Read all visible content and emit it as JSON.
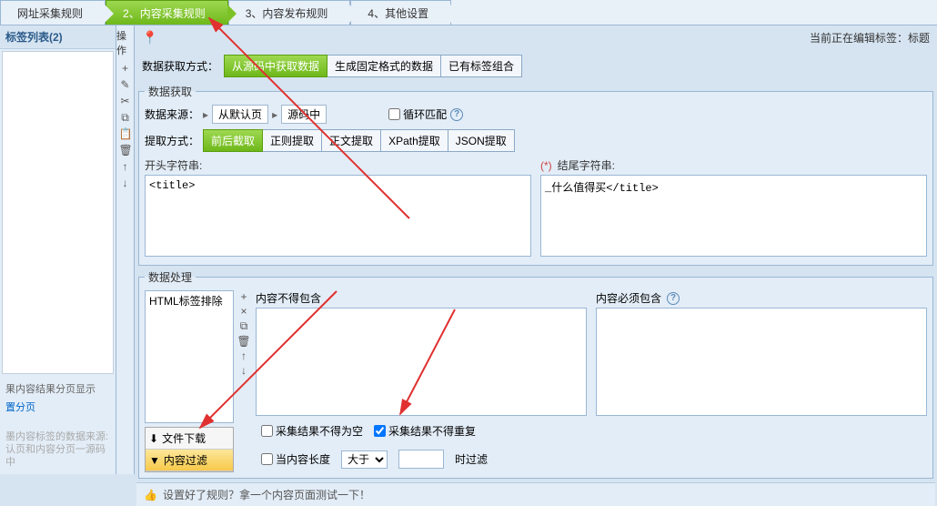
{
  "tabs": {
    "t1": "网址采集规则",
    "t2": "2、内容采集规则",
    "t3": "3、内容发布规则",
    "t4": "4、其他设置"
  },
  "left": {
    "header": "标签列表(2)",
    "op_label": "操作",
    "paging_title": "果内容结果分页显示",
    "paging_link": "置分页",
    "hint1": "墨内容标签的数据来源:",
    "hint2": "认页和内容分页一源码中"
  },
  "top": {
    "pin_icon": "pin-icon",
    "status_prefix": "当前正在编辑标签：",
    "status_value": "标题",
    "extract_method_label": "数据获取方式：",
    "method_btn1": "从源码中获取数据",
    "method_btn2": "生成固定格式的数据",
    "method_btn3": "已有标签组合"
  },
  "acquire": {
    "legend": "数据获取",
    "src_label": "数据来源：",
    "src1": "从默认页",
    "src2": "源码中",
    "loop_label": "循环匹配",
    "ext_label": "提取方式：",
    "ext_btns": [
      "前后截取",
      "正则提取",
      "正文提取",
      "XPath提取",
      "JSON提取"
    ],
    "start_label": "开头字符串:",
    "end_star": "(*)",
    "end_label": "结尾字符串:",
    "start_value": "<title>",
    "end_value": "_什么值得买</title>"
  },
  "process": {
    "legend": "数据处理",
    "list_item": "HTML标签排除",
    "not_contain_label": "内容不得包含",
    "must_contain_label": "内容必须包含",
    "bt1": "文件下载",
    "bt2": "内容过滤",
    "chk_notempty": "采集结果不得为空",
    "chk_norepeat": "采集结果不得重复",
    "len_label": "当内容长度",
    "len_op": "大于",
    "len_suffix": "时过滤"
  },
  "footer": {
    "text": "设置好了规则？拿一个内容页面测试一下！"
  }
}
